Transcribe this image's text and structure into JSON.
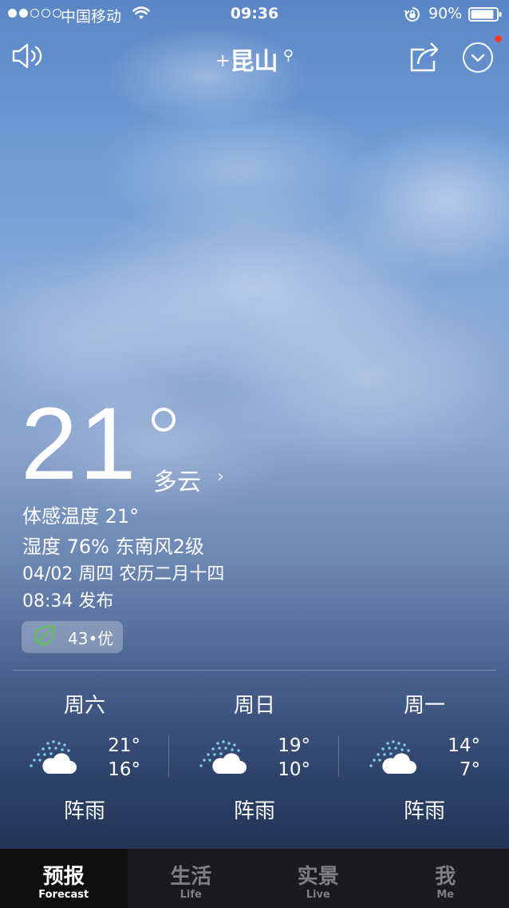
{
  "status_bar": {
    "carrier": "中国移动",
    "time": "09:36",
    "battery_percent": "90%",
    "battery_level": 0.9,
    "signal_bars": 2
  },
  "header": {
    "plus": "+",
    "city": "昆山",
    "icons": [
      "speaker-icon",
      "share-icon",
      "chevron-down-icon"
    ]
  },
  "current": {
    "temperature": "21",
    "condition": "多云",
    "feels_like": "体感温度 21°",
    "humidity_wind": "湿度 76% 东南风2级",
    "date": "04/02 周四 农历二月十四",
    "published": "08:34 发布",
    "aqi": "43•优",
    "aqi_color": "#5fbf5a"
  },
  "forecast": [
    {
      "day": "周六",
      "high": "21°",
      "low": "16°",
      "desc": "阵雨",
      "icon": "shower-rain-icon"
    },
    {
      "day": "周日",
      "high": "19°",
      "low": "10°",
      "desc": "阵雨",
      "icon": "shower-rain-icon"
    },
    {
      "day": "周一",
      "high": "14°",
      "low": "7°",
      "desc": "阵雨",
      "icon": "shower-rain-icon"
    }
  ],
  "tabs": [
    {
      "zh": "预报",
      "en": "Forecast",
      "active": true
    },
    {
      "zh": "生活",
      "en": "Life",
      "active": false
    },
    {
      "zh": "实景",
      "en": "Live",
      "active": false
    },
    {
      "zh": "我",
      "en": "Me",
      "active": false
    }
  ]
}
